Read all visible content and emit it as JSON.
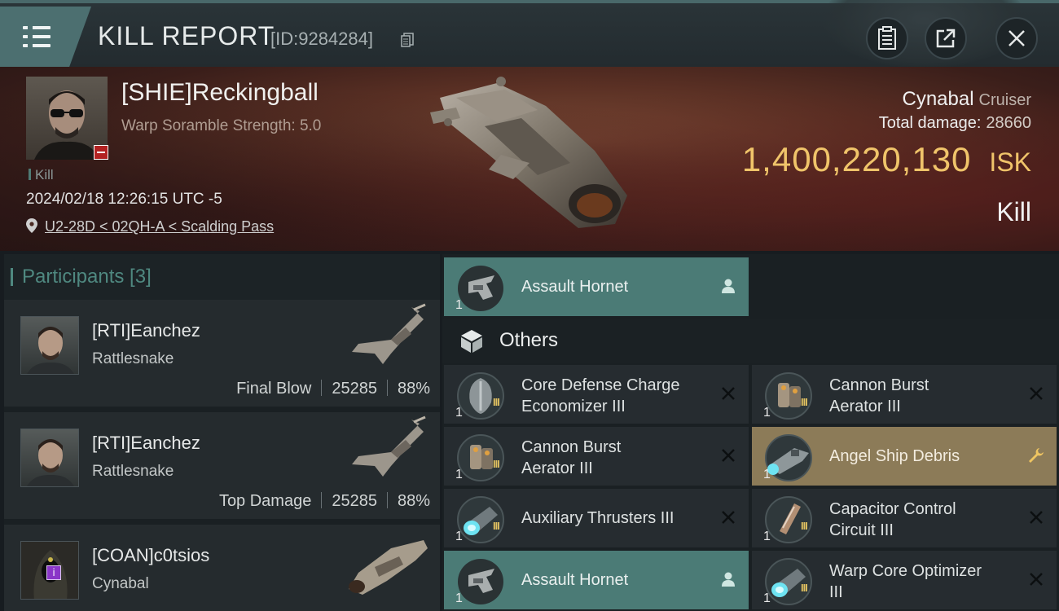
{
  "header": {
    "title": "KILL REPORT",
    "report_id": "[ID:9284284]"
  },
  "victim": {
    "name": "[SHIE]Reckingball",
    "subtitle": "Warp Soramble Strength: 5.0",
    "tag": "Kill",
    "timestamp": "2024/02/18 12:26:15 UTC -5",
    "location": "U2-28D < 02QH-A < Scalding Pass",
    "ship": "Cynabal",
    "ship_class": "Cruiser",
    "damage_label": "Total damage:",
    "damage_value": "28660",
    "isk_value": "1,400,220,130",
    "isk_unit": "ISK",
    "result": "Kill"
  },
  "participants": {
    "title": "Participants [3]",
    "items": [
      {
        "name": "[RTI]Eanchez",
        "ship": "Rattlesnake",
        "role": "Final Blow",
        "damage": "25285",
        "percent": "88%"
      },
      {
        "name": "[RTI]Eanchez",
        "ship": "Rattlesnake",
        "role": "Top Damage",
        "damage": "25285",
        "percent": "88%"
      },
      {
        "name": "[COAN]c0tsios",
        "ship": "Cynabal",
        "role": "",
        "damage": "",
        "percent": ""
      }
    ]
  },
  "modules": {
    "drone_top": {
      "qty": "1",
      "name": "Assault Hornet"
    },
    "others_label": "Others",
    "left": [
      {
        "qty": "1",
        "line1": "Core Defense Charge",
        "line2": "Economizer III"
      },
      {
        "qty": "1",
        "line1": "Cannon Burst",
        "line2": "Aerator III"
      },
      {
        "qty": "1",
        "line1": "Auxiliary Thrusters III",
        "line2": ""
      },
      {
        "qty": "1",
        "line1": "Assault Hornet",
        "line2": ""
      }
    ],
    "right": [
      {
        "qty": "1",
        "line1": "Cannon Burst",
        "line2": "Aerator III"
      },
      {
        "qty": "1",
        "line1": "Angel Ship Debris",
        "line2": ""
      },
      {
        "qty": "1",
        "line1": "Capacitor Control",
        "line2": "Circuit III"
      },
      {
        "qty": "1",
        "line1": "Warp Core Optimizer",
        "line2": "III"
      }
    ]
  },
  "colors": {
    "accent_teal": "#4b7b76",
    "isk_gold": "#f0c46a",
    "dropped_gold": "#8c7b58"
  }
}
